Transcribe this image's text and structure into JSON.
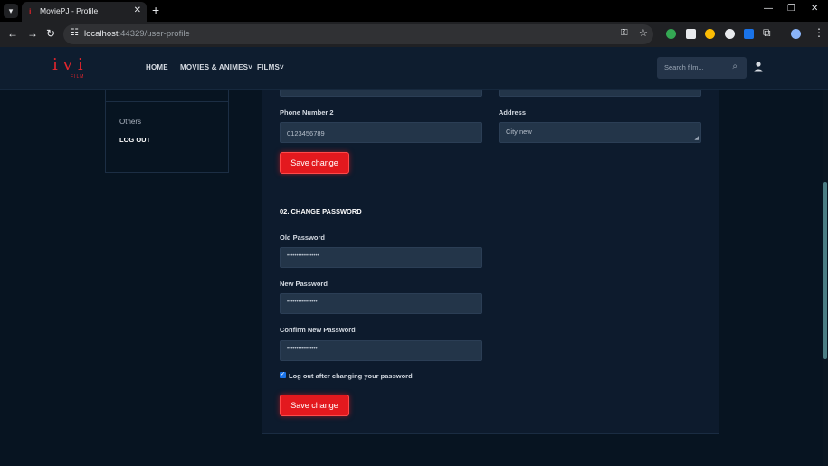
{
  "browser": {
    "tab_title": "MoviePJ - Profile",
    "url_host": "localhost",
    "url_rest": ":44329/user-profile",
    "icons": [
      "tab-list-icon",
      "close-icon",
      "new-tab-icon",
      "minimize-icon",
      "restore-icon",
      "window-close-icon",
      "back-icon",
      "forward-icon",
      "reload-icon",
      "site-settings-icon",
      "password-key-icon",
      "bookmark-star-icon",
      "extensions-icon",
      "profile-icon",
      "menu-icon"
    ]
  },
  "site": {
    "logo_letters": "ivi",
    "logo_sub": "FILM",
    "nav": [
      "HOME",
      "MOVIES & ANIMES",
      "FILMS"
    ],
    "search_placeholder": "Search film..."
  },
  "sidebar": {
    "items": [
      "Others",
      "LOG OUT"
    ]
  },
  "profile_form": {
    "phone2_label": "Phone Number 2",
    "phone2_value": "0123456789",
    "address_label": "Address",
    "address_value": "City new",
    "save_label": "Save change"
  },
  "password_form": {
    "section_title": "02. CHANGE PASSWORD",
    "old_label": "Old Password",
    "old_value": "•••••••••••••••••",
    "new_label": "New Password",
    "new_value": "••••••••••••••••",
    "confirm_label": "Confirm New Password",
    "confirm_value": "••••••••••••••••",
    "logout_checkbox_label": "Log out after changing your password",
    "logout_checked": true,
    "save_label": "Save change"
  },
  "colors": {
    "accent": "#e3191e",
    "background": "#071421",
    "panel": "#0d1b2d",
    "input": "#233549"
  }
}
